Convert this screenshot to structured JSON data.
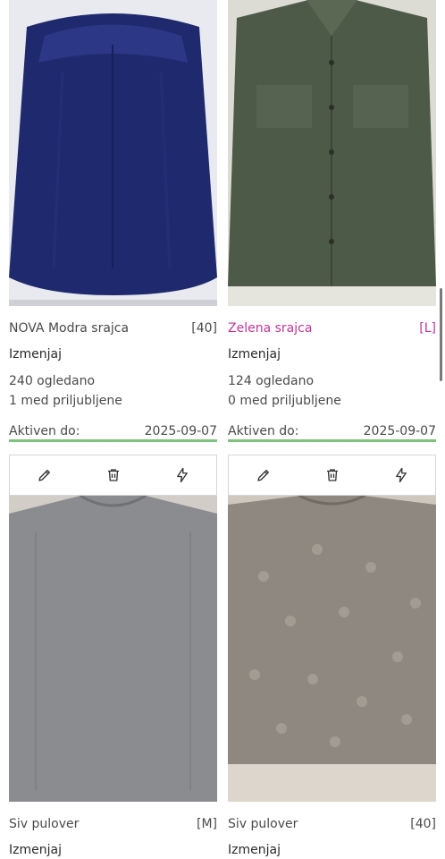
{
  "listings": [
    {
      "title": "NOVA Modra srajca",
      "size": "[40]",
      "edit_label": "Izmenjaj",
      "views": "240 ogledano",
      "favorites": "1 med priljubljene",
      "active_label": "Aktiven do:",
      "active_date": "2025-09-07",
      "title_color": "#4a4a4a"
    },
    {
      "title": "Zelena srajca",
      "size": "[L]",
      "edit_label": "Izmenjaj",
      "views": "124 ogledano",
      "favorites": "0 med priljubljene",
      "active_label": "Aktiven do:",
      "active_date": "2025-09-07",
      "title_color": "#c1359a"
    },
    {
      "title": "Siv pulover",
      "size": "[M]",
      "edit_label": "Izmenjaj"
    },
    {
      "title": "Siv pulover",
      "size": "[40]",
      "edit_label": "Izmenjaj"
    }
  ],
  "icons": {
    "edit": "pencil-icon",
    "delete": "trash-icon",
    "boost": "lightning-icon"
  },
  "colors": {
    "active_underline": "#7ec27e",
    "toolbar_border": "#d6d6d6"
  }
}
